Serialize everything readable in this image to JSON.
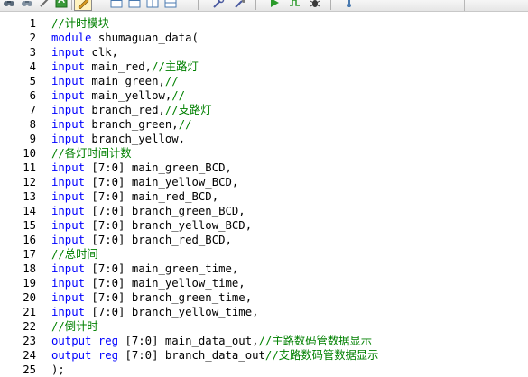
{
  "toolbar": {
    "buttons": [
      {
        "name": "find-icon",
        "icon": "binoculars"
      },
      {
        "name": "find-next-icon",
        "icon": "binoculars-arrow"
      },
      {
        "name": "replace-icon",
        "icon": "wand"
      },
      {
        "name": "refresh-icon",
        "icon": "refresh"
      },
      {
        "name": "edit-icon",
        "icon": "pencil"
      },
      {
        "name": "window-icon-1",
        "icon": "window"
      },
      {
        "name": "window-icon-2",
        "icon": "window"
      },
      {
        "name": "window-icon-3",
        "icon": "window"
      },
      {
        "name": "window-icon-4",
        "icon": "window"
      },
      {
        "name": "tools-icon",
        "icon": "wrench"
      },
      {
        "name": "compile-icon",
        "icon": "wrench-gear"
      },
      {
        "name": "run-icon",
        "icon": "play"
      },
      {
        "name": "wave-icon",
        "icon": "wave"
      },
      {
        "name": "debug-icon",
        "icon": "bug"
      },
      {
        "name": "probe-icon",
        "icon": "probe"
      }
    ]
  },
  "colors": {
    "keyword": "#0000ff",
    "comment": "#008000",
    "text": "#000000",
    "line_number": "#000000"
  },
  "editor": {
    "lines": [
      {
        "num": "1",
        "tokens": [
          {
            "t": "//计时模块",
            "c": "comment"
          }
        ]
      },
      {
        "num": "2",
        "tokens": [
          {
            "t": "module",
            "c": "kw"
          },
          {
            "t": " shumaguan_data(",
            "c": "text"
          }
        ]
      },
      {
        "num": "3",
        "tokens": [
          {
            "t": "input",
            "c": "kw"
          },
          {
            "t": " clk,",
            "c": "text"
          }
        ]
      },
      {
        "num": "4",
        "tokens": [
          {
            "t": "input",
            "c": "kw"
          },
          {
            "t": " main_red,",
            "c": "text"
          },
          {
            "t": "//主路灯",
            "c": "comment"
          }
        ]
      },
      {
        "num": "5",
        "tokens": [
          {
            "t": "input",
            "c": "kw"
          },
          {
            "t": " main_green,",
            "c": "text"
          },
          {
            "t": "//",
            "c": "comment"
          }
        ]
      },
      {
        "num": "6",
        "tokens": [
          {
            "t": "input",
            "c": "kw"
          },
          {
            "t": " main_yellow,",
            "c": "text"
          },
          {
            "t": "//",
            "c": "comment"
          }
        ]
      },
      {
        "num": "7",
        "tokens": [
          {
            "t": "input",
            "c": "kw"
          },
          {
            "t": " branch_red,",
            "c": "text"
          },
          {
            "t": "//支路灯",
            "c": "comment"
          }
        ]
      },
      {
        "num": "8",
        "tokens": [
          {
            "t": "input",
            "c": "kw"
          },
          {
            "t": " branch_green,",
            "c": "text"
          },
          {
            "t": "//",
            "c": "comment"
          }
        ]
      },
      {
        "num": "9",
        "tokens": [
          {
            "t": "input",
            "c": "kw"
          },
          {
            "t": " branch_yellow,",
            "c": "text"
          }
        ]
      },
      {
        "num": "10",
        "tokens": [
          {
            "t": "//各灯时间计数",
            "c": "comment"
          }
        ]
      },
      {
        "num": "11",
        "tokens": [
          {
            "t": "input",
            "c": "kw"
          },
          {
            "t": " [7:0] main_green_BCD,",
            "c": "text"
          }
        ]
      },
      {
        "num": "12",
        "tokens": [
          {
            "t": "input",
            "c": "kw"
          },
          {
            "t": " [7:0] main_yellow_BCD,",
            "c": "text"
          }
        ]
      },
      {
        "num": "13",
        "tokens": [
          {
            "t": "input",
            "c": "kw"
          },
          {
            "t": " [7:0] main_red_BCD,",
            "c": "text"
          }
        ]
      },
      {
        "num": "14",
        "tokens": [
          {
            "t": "input",
            "c": "kw"
          },
          {
            "t": " [7:0] branch_green_BCD,",
            "c": "text"
          }
        ]
      },
      {
        "num": "15",
        "tokens": [
          {
            "t": "input",
            "c": "kw"
          },
          {
            "t": " [7:0] branch_yellow_BCD,",
            "c": "text"
          }
        ]
      },
      {
        "num": "16",
        "tokens": [
          {
            "t": "input",
            "c": "kw"
          },
          {
            "t": " [7:0] branch_red_BCD,",
            "c": "text"
          }
        ]
      },
      {
        "num": "17",
        "tokens": [
          {
            "t": "//总时间",
            "c": "comment"
          }
        ]
      },
      {
        "num": "18",
        "tokens": [
          {
            "t": "input",
            "c": "kw"
          },
          {
            "t": " [7:0] main_green_time,",
            "c": "text"
          }
        ]
      },
      {
        "num": "19",
        "tokens": [
          {
            "t": "input",
            "c": "kw"
          },
          {
            "t": " [7:0] main_yellow_time,",
            "c": "text"
          }
        ]
      },
      {
        "num": "20",
        "tokens": [
          {
            "t": "input",
            "c": "kw"
          },
          {
            "t": " [7:0] branch_green_time,",
            "c": "text"
          }
        ]
      },
      {
        "num": "21",
        "tokens": [
          {
            "t": "input",
            "c": "kw"
          },
          {
            "t": " [7:0] branch_yellow_time,",
            "c": "text"
          }
        ]
      },
      {
        "num": "22",
        "tokens": [
          {
            "t": "//倒计时",
            "c": "comment"
          }
        ]
      },
      {
        "num": "23",
        "tokens": [
          {
            "t": "output",
            "c": "kw"
          },
          {
            "t": " ",
            "c": "text"
          },
          {
            "t": "reg",
            "c": "kw"
          },
          {
            "t": " [7:0] main_data_out,",
            "c": "text"
          },
          {
            "t": "//主路数码管数据显示",
            "c": "comment"
          }
        ]
      },
      {
        "num": "24",
        "tokens": [
          {
            "t": "output",
            "c": "kw"
          },
          {
            "t": " ",
            "c": "text"
          },
          {
            "t": "reg",
            "c": "kw"
          },
          {
            "t": " [7:0] branch_data_out",
            "c": "text"
          },
          {
            "t": "//支路数码管数据显示",
            "c": "comment"
          }
        ]
      },
      {
        "num": "25",
        "tokens": [
          {
            "t": ");",
            "c": "text"
          }
        ]
      }
    ]
  }
}
